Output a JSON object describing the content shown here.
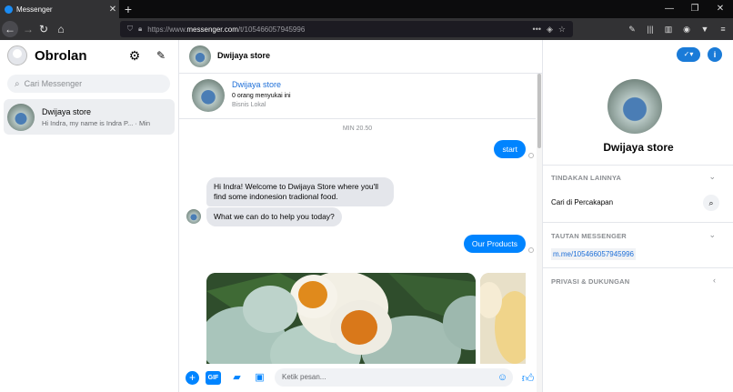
{
  "browser": {
    "tab_title": "Messenger",
    "url_prefix": "https://www.",
    "url_host": "messenger.com",
    "url_path": "/t/105466057945996"
  },
  "sidebar": {
    "title": "Obrolan",
    "search_placeholder": "Cari Messenger",
    "conversations": [
      {
        "name": "Dwijaya store",
        "preview": "Hi Indra, my name is Indra P... · Min"
      }
    ]
  },
  "chat": {
    "header_name": "Dwijaya store",
    "page_name": "Dwijaya store",
    "page_likes": "0 orang menyukai ini",
    "page_category": "Bisnis Lokal",
    "timestamp": "MIN 20.50",
    "messages": [
      {
        "from": "me",
        "text": "start"
      },
      {
        "from": "them",
        "text": "Hi Indra! Welcome to Dwijaya Store where you'll find some indonesion tradional food."
      },
      {
        "from": "them",
        "text": "What we can do to help you today?"
      },
      {
        "from": "me",
        "text": "Our Products"
      }
    ],
    "composer_placeholder": "Ketik pesan...",
    "composer_gif": "GIF"
  },
  "info_panel": {
    "name": "Dwijaya store",
    "sections": {
      "more_actions": "TINDAKAN LAINNYA",
      "search_in_conversation": "Cari di Percakapan",
      "messenger_link_title": "TAUTAN MESSENGER",
      "messenger_link": "m.me/105466057945996",
      "privacy": "PRIVASI & DUKUNGAN"
    }
  },
  "colors": {
    "accent": "#0084ff",
    "link": "#1e6fd8"
  }
}
